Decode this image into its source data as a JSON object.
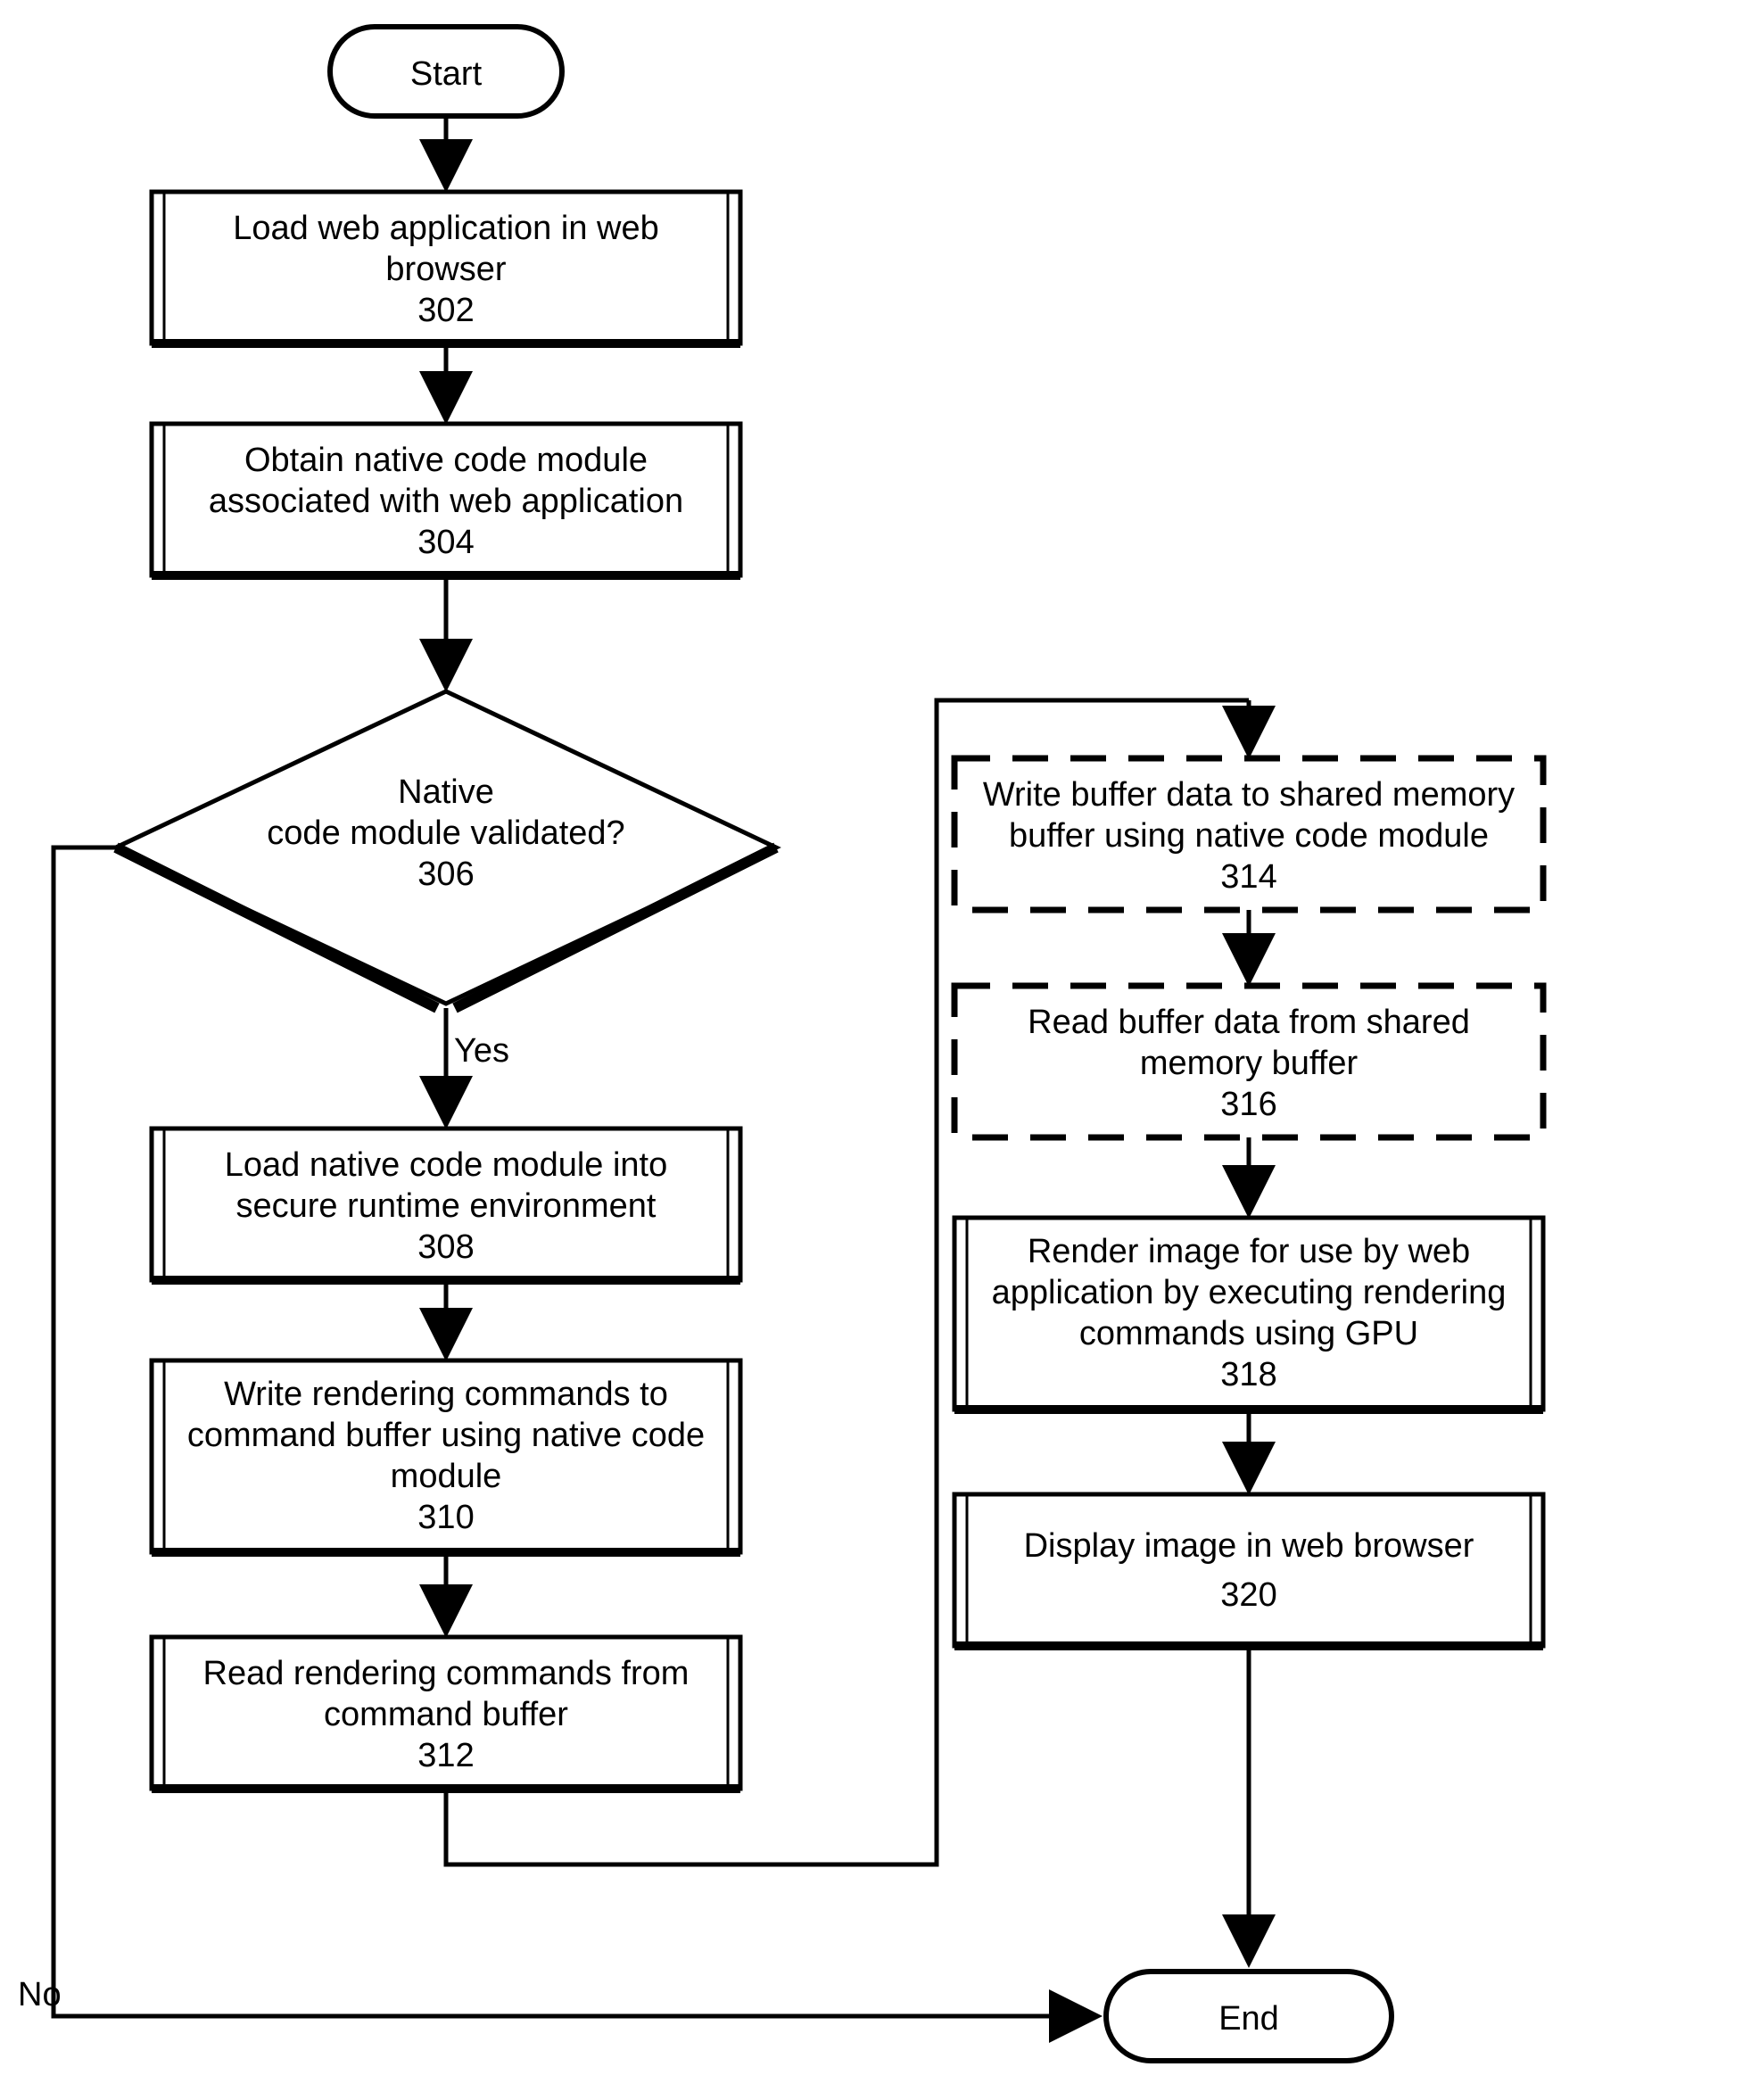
{
  "flow": {
    "start": "Start",
    "end": "End",
    "no": "No",
    "yes": "Yes",
    "steps": {
      "n302": {
        "line1": "Load web application in web",
        "line2": "browser",
        "ref": "302"
      },
      "n304": {
        "line1": "Obtain native code module",
        "line2": "associated with web application",
        "ref": "304"
      },
      "n306": {
        "line1": "Native",
        "line2": "code module validated?",
        "ref": "306"
      },
      "n308": {
        "line1": "Load native code module into",
        "line2": "secure runtime environment",
        "ref": "308"
      },
      "n310": {
        "line1": "Write rendering commands to",
        "line2": "command buffer using native code",
        "line3": "module",
        "ref": "310"
      },
      "n312": {
        "line1": "Read rendering commands from",
        "line2": "command buffer",
        "ref": "312"
      },
      "n314": {
        "line1": "Write buffer data to shared memory",
        "line2": "buffer using native code module",
        "ref": "314"
      },
      "n316": {
        "line1": "Read buffer data from shared",
        "line2": "memory buffer",
        "ref": "316"
      },
      "n318": {
        "line1": "Render image for use by web",
        "line2": "application by executing rendering",
        "line3": "commands using GPU",
        "ref": "318"
      },
      "n320": {
        "line1": "Display image in web browser",
        "ref": "320"
      }
    }
  }
}
